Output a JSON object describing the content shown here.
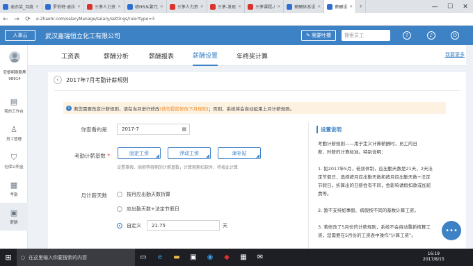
{
  "browser": {
    "tabs": [
      {
        "label": "迪亦奖_百度",
        "color": "#2f6fd1"
      },
      {
        "label": "罗伯特·迪拉",
        "color": "#2f6fd1"
      },
      {
        "label": "三茅人力资",
        "color": "#d9342b"
      },
      {
        "label": "绩HR从繁冗",
        "color": "#2f6fd1"
      },
      {
        "label": "三茅人力资",
        "color": "#d9342b"
      },
      {
        "label": "三茅-发现",
        "color": "#d9342b"
      },
      {
        "label": "三茅课程-/",
        "color": "#d9342b"
      },
      {
        "label": "薪酬体系设",
        "color": "#2f6fd1"
      },
      {
        "label": "薪酬设",
        "color": "#2f6fd1",
        "active": true
      }
    ],
    "url": "e.2haohr.com/salaryManage/salary/settings/rule?type=3",
    "window_buttons": [
      "—",
      "☐",
      "✕"
    ]
  },
  "app": {
    "logo": "人事云",
    "company": "武汉嘉瑞恒立化工有限公司",
    "feedback_label": "我要吐槽",
    "search_placeholder": "搜索员工",
    "accent": "#3e82c6"
  },
  "sidebar": {
    "user_name": "安黎明刚刚黑",
    "user_id": "98914",
    "items": [
      {
        "label": "我的工作台",
        "icon": "desk-icon"
      },
      {
        "label": "员工管理",
        "icon": "person-icon"
      },
      {
        "label": "社保公积金",
        "icon": "shield-icon"
      },
      {
        "label": "考勤",
        "icon": "calendar-icon"
      },
      {
        "label": "薪酬",
        "icon": "wallet-icon",
        "active": true
      }
    ]
  },
  "subnav": {
    "tabs": [
      "工资表",
      "薪酬分析",
      "薪酬报表",
      "薪酬设置",
      "年终奖计算"
    ],
    "active": "薪酬设置",
    "link": "我要更多"
  },
  "page": {
    "title": "2017年7月考勤计薪规则",
    "notice_prefix": "若您需要改变计薪规则，请在当月进行修改",
    "notice_link": "(请勿提前修改下月规则)",
    "notice_suffix": "；否则，系统将会自动延用上月计薪规则。",
    "month_label": "你查看的是",
    "month_value": "2017-7",
    "base_label": "考勤计薪基数",
    "base_options": [
      "固定工资",
      "浮动工资",
      "津补贴"
    ],
    "base_hint": "设置事假、病假等假期的计薪基数，计算假期扣款时，将按此计算",
    "days_label": "月计薪天数",
    "day_options": [
      "按月应出勤天数折算",
      "应出勤天数+法定节假日",
      "自定义"
    ],
    "custom_value": "21.75",
    "custom_unit": "天"
  },
  "help": {
    "title": "设置说明",
    "lines": [
      "考勤计薪规则——用于定义计算薪酬时，员工的日",
      "薪、时薪的计算标准。特别说明：",
      "",
      "1. 如2017年5月，若双休制，应出勤天数是21天，2天法",
      "定节假日，选择按月应出勤天数和按月应出勤天数+法定",
      "节假日，折算出的日薪会有不同，会影响请假扣款或加班",
      "费等。",
      "",
      "2. 暂不支持如事假、病假按不同的基数计算工资。",
      "",
      "3. 若修改了5月份的计薪规则，系统不会自动重新核算工",
      "资，您需要在5月份的工资表中操作“计算工资”。"
    ]
  },
  "taskbar": {
    "search_text": "在这里输入你要搜索的内容",
    "time": "16:19",
    "date": "2017/8/15"
  }
}
